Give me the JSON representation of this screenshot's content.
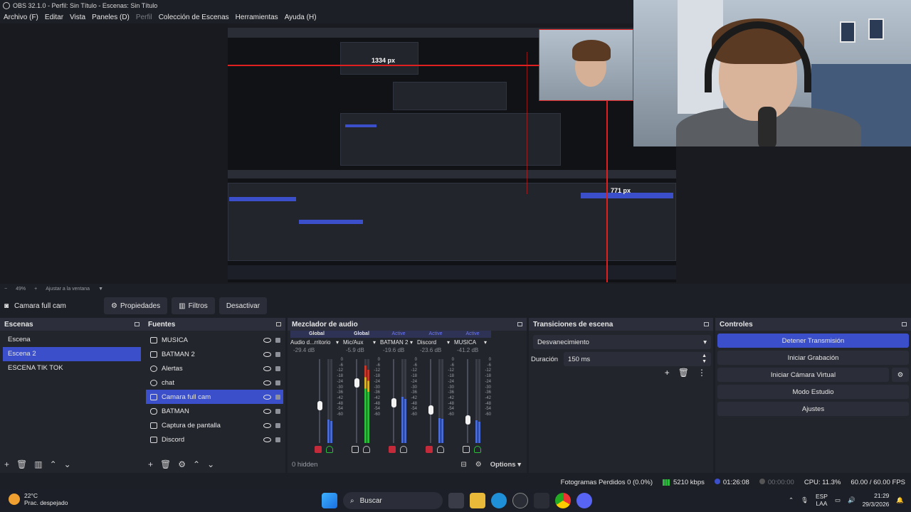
{
  "window": {
    "title": "OBS 32.1.0 - Perfil: Sin Título - Escenas: Sin Título"
  },
  "menu": [
    {
      "label": "Archivo (F)",
      "enabled": true
    },
    {
      "label": "Editar",
      "enabled": true
    },
    {
      "label": "Vista",
      "enabled": true
    },
    {
      "label": "Paneles (D)",
      "enabled": true
    },
    {
      "label": "Perfil",
      "enabled": false
    },
    {
      "label": "Colección de Escenas",
      "enabled": true
    },
    {
      "label": "Herramientas",
      "enabled": true
    },
    {
      "label": "Ayuda (H)",
      "enabled": true
    }
  ],
  "preview": {
    "measure_top": "1334 px",
    "measure_right": "771 px"
  },
  "zoom": {
    "level": "49%",
    "fit": "Ajustar a la ventana"
  },
  "context": {
    "source": "Camara full cam",
    "properties": "Propiedades",
    "filters": "Filtros",
    "deactivate": "Desactivar"
  },
  "scenes": {
    "title": "Escenas",
    "items": [
      "Escena",
      "Escena 2",
      "ESCENA TIK TOK"
    ],
    "active_index": 1
  },
  "sources": {
    "title": "Fuentes",
    "items": [
      "MUSICA",
      "BATMAN 2",
      "Alertas",
      "chat",
      "Camara full cam",
      "BATMAN",
      "Captura de pantalla",
      "Discord"
    ],
    "active_index": 4
  },
  "mixer": {
    "title": "Mezclador de audio",
    "channels": [
      {
        "status": "Global",
        "name": "Audio d...rritorio",
        "db": "-29.4 dB",
        "level": 0.28,
        "fader": 0.45,
        "muted": true
      },
      {
        "status": "Global",
        "name": "Mic/Aux",
        "db": "-5.9 dB",
        "level": 0.92,
        "fader": 0.72,
        "muted": false
      },
      {
        "status": "Active",
        "name": "BATMAN 2",
        "db": "-19.6 dB",
        "level": 0.55,
        "fader": 0.48,
        "muted": true
      },
      {
        "status": "Active",
        "name": "Discord",
        "db": "-23.6 dB",
        "level": 0.3,
        "fader": 0.4,
        "muted": true
      },
      {
        "status": "Active",
        "name": "MUSICA",
        "db": "-41.2 dB",
        "level": 0.27,
        "fader": 0.28,
        "muted": false
      }
    ],
    "scale": [
      "0",
      "-6",
      "-12",
      "-18",
      "-24",
      "-30",
      "-36",
      "-42",
      "-48",
      "-54",
      "-60"
    ],
    "hidden": "0 hidden",
    "options": "Options"
  },
  "transitions": {
    "title": "Transiciones de escena",
    "selected": "Desvanecimiento",
    "duration_label": "Duración",
    "duration_value": "150 ms"
  },
  "controls": {
    "title": "Controles",
    "stop_stream": "Detener Transmisión",
    "start_recording": "Iniciar Grabación",
    "virtual_cam": "Iniciar Cámara Virtual",
    "studio_mode": "Modo Estudio",
    "settings": "Ajustes"
  },
  "status": {
    "dropped": "Fotogramas Perdidos 0 (0.0%)",
    "bitrate": "5210 kbps",
    "stream_time": "01:26:08",
    "rec_time": "00:00:00",
    "cpu": "CPU: 11.3%",
    "fps": "60.00 / 60.00 FPS"
  },
  "taskbar": {
    "temp": "22°C",
    "weather": "Prac. despejado",
    "search": "Buscar",
    "lang_1": "ESP",
    "lang_2": "LAA",
    "time": "21:29",
    "date": "29/3/2026"
  },
  "colors": {
    "accent": "#3a4fc9",
    "meter_green": "#2dbb3d",
    "meter_blue": "#4a6ad0",
    "mute_red": "#c42b3a",
    "red_guide": "#e02020"
  }
}
